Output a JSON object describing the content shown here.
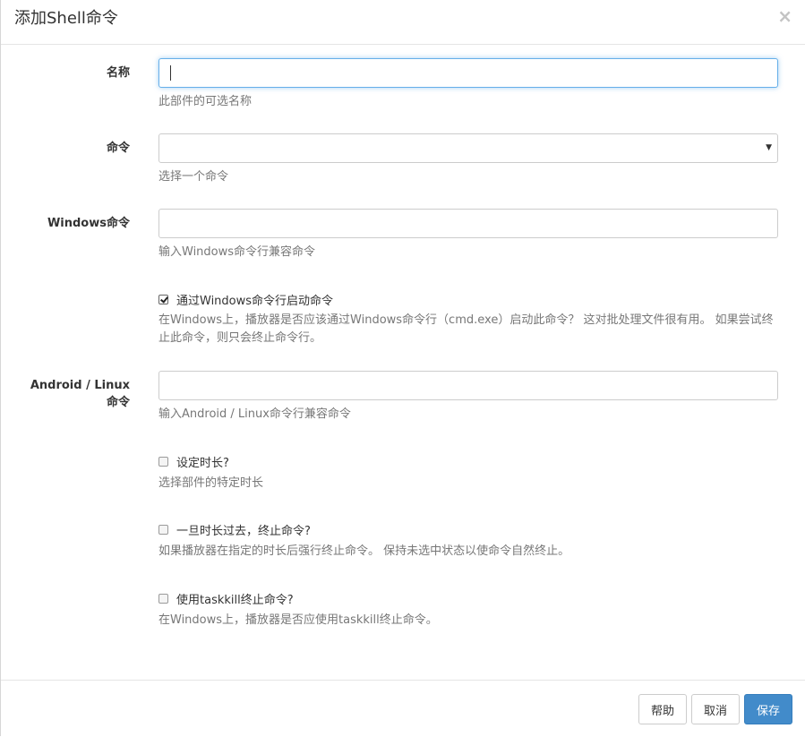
{
  "modal": {
    "title": "添加Shell命令",
    "close_symbol": "×"
  },
  "form": {
    "name": {
      "label": "名称",
      "value": "",
      "help": "此部件的可选名称"
    },
    "command": {
      "label": "命令",
      "selected": "",
      "arrow": "▼",
      "help": "选择一个命令"
    },
    "windows_command": {
      "label": "Windows命令",
      "value": "",
      "help": "输入Windows命令行兼容命令"
    },
    "launch_through_cmd": {
      "label": "通过Windows命令行启动命令",
      "checked": true,
      "help": "在Windows上，播放器是否应该通过Windows命令行（cmd.exe）启动此命令？ 这对批处理文件很有用。 如果尝试终止此命令，则只会终止命令行。"
    },
    "linux_command": {
      "label_line1": "Android / Linux",
      "label_line2": "命令",
      "value": "",
      "help": "输入Android / Linux命令行兼容命令"
    },
    "set_duration": {
      "label": "设定时长?",
      "checked": false,
      "help": "选择部件的特定时长"
    },
    "terminate_on_expiry": {
      "label": "一旦时长过去，终止命令?",
      "checked": false,
      "help": "如果播放器在指定的时长后强行终止命令。 保持未选中状态以使命令自然终止。"
    },
    "use_taskkill": {
      "label": "使用taskkill终止命令?",
      "checked": false,
      "help": "在Windows上，播放器是否应使用taskkill终止命令。"
    }
  },
  "footer": {
    "help_label": "帮助",
    "cancel_label": "取消",
    "save_label": "保存"
  },
  "colors": {
    "primary": "#428bca",
    "focus_border": "#66afe9",
    "help_text": "#777777"
  }
}
